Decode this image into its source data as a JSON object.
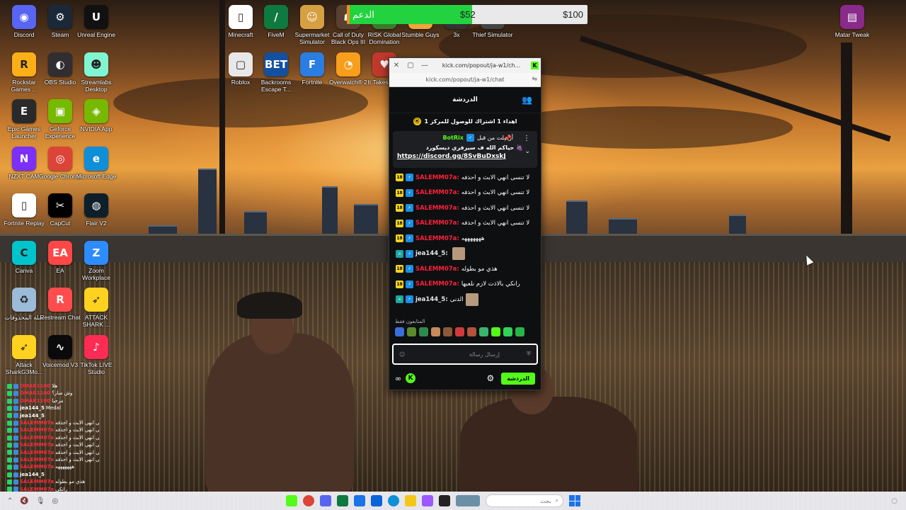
{
  "desktop_icons": [
    {
      "id": "discord",
      "label": "Discord",
      "color": "#5865f2",
      "glyph": "◉"
    },
    {
      "id": "steam",
      "label": "Steam",
      "color": "#1b2838",
      "glyph": "⚙"
    },
    {
      "id": "unreal",
      "label": "Unreal Engine",
      "color": "#111111",
      "glyph": "U"
    },
    {
      "id": "rockstar",
      "label": "Rockstar Games ...",
      "color": "#fcaf17",
      "glyph": "R"
    },
    {
      "id": "obs",
      "label": "OBS Studio",
      "color": "#302e31",
      "glyph": "◐"
    },
    {
      "id": "streamlabs",
      "label": "Streamlabs Desktop",
      "color": "#80f5d2",
      "glyph": "☻"
    },
    {
      "id": "epic",
      "label": "Epic Games Launcher",
      "color": "#2a2a2a",
      "glyph": "E"
    },
    {
      "id": "geforce",
      "label": "Geforce Experience",
      "color": "#76b900",
      "glyph": "▣"
    },
    {
      "id": "nvidia",
      "label": "NVIDIA App",
      "color": "#76b900",
      "glyph": "◈"
    },
    {
      "id": "nzxt",
      "label": "NZXT CAM",
      "color": "#7b2ff7",
      "glyph": "N"
    },
    {
      "id": "chrome",
      "label": "Google Chrome",
      "color": "#db4437",
      "glyph": "◎"
    },
    {
      "id": "edge",
      "label": "Microsoft Edge",
      "color": "#0f8fd8",
      "glyph": "e"
    },
    {
      "id": "fortnite",
      "label": "Fortnite Replay",
      "color": "#ffffff",
      "glyph": "▯"
    },
    {
      "id": "capcut",
      "label": "CapCut",
      "color": "#000000",
      "glyph": "✂"
    },
    {
      "id": "blackhole",
      "label": "Flair V2",
      "color": "#0d1f2a",
      "glyph": "◍"
    },
    {
      "id": "canva",
      "label": "Canva",
      "color": "#00c4cc",
      "glyph": "C"
    },
    {
      "id": "ea",
      "label": "EA",
      "color": "#ff4747",
      "glyph": "EA"
    },
    {
      "id": "zoom",
      "label": "Zoom Workplace",
      "color": "#2d8cff",
      "glyph": "Z"
    },
    {
      "id": "recycle",
      "label": "سلة المحذوفات",
      "color": "#9bbbd8",
      "glyph": "♻"
    },
    {
      "id": "restream",
      "label": "Restream Chat",
      "color": "#ff4c4c",
      "glyph": "R"
    },
    {
      "id": "attackshark",
      "label": "ATTACK SHARK ...",
      "color": "#ffd21f",
      "glyph": "➶"
    },
    {
      "id": "attack2",
      "label": "Attack SharkG3Mo...",
      "color": "#ffd21f",
      "glyph": "➶"
    },
    {
      "id": "voicemod",
      "label": "Voicemod V3",
      "color": "#0a0a0a",
      "glyph": "∿"
    },
    {
      "id": "tiktok",
      "label": "TikTok LIVE Studio",
      "color": "#fe2c55",
      "glyph": "♪"
    },
    {
      "id": "minecraft",
      "label": "Minecraft",
      "color": "#ffffff",
      "glyph": "▯"
    },
    {
      "id": "fivem",
      "label": "FiveM",
      "color": "#0f7a3f",
      "glyph": "/"
    },
    {
      "id": "supermarket",
      "label": "Supermarket Simulator",
      "color": "#d6a042",
      "glyph": "☺"
    },
    {
      "id": "cod",
      "label": "Call of Duty Black Ops III",
      "color": "#5a4030",
      "glyph": "☗"
    },
    {
      "id": "risk",
      "label": "RISK Global Domination",
      "color": "#3a7a2a",
      "glyph": "◆"
    },
    {
      "id": "stumble",
      "label": "Stumble Guys",
      "color": "#f2a43a",
      "glyph": "S"
    },
    {
      "id": "unknown1",
      "label": "3x",
      "color": "#333333",
      "glyph": "3"
    },
    {
      "id": "thief",
      "label": "Thief Simulator",
      "color": "#444444",
      "glyph": "T"
    },
    {
      "id": "roblox",
      "label": "Roblox",
      "color": "#e8e8e8",
      "glyph": "▢"
    },
    {
      "id": "backrooms",
      "label": "Backrooms Escape T...",
      "color": "#1450a0",
      "glyph": "BET"
    },
    {
      "id": "fortnite2",
      "label": "Fortnite",
      "color": "#2a7de1",
      "glyph": "F"
    },
    {
      "id": "overwatch",
      "label": "Overwatch® 2",
      "color": "#f99e1a",
      "glyph": "◔"
    },
    {
      "id": "ittakes",
      "label": "It Takes Two",
      "color": "#c0392b",
      "glyph": "♥"
    },
    {
      "id": "winrar",
      "label": "Matar Tweak",
      "color": "#8a2a8a",
      "glyph": "▤"
    }
  ],
  "donation_bar": {
    "label": "الدعم",
    "current": "$52",
    "goal": "$100",
    "progress": 0.52,
    "fill_color": "#22d33f"
  },
  "chat_window": {
    "tab_title": "kick.com/popout/ja-w1/ch...",
    "url": "kick.com/popout/ja-w1/chat",
    "header": "الدردشة",
    "goal_text": "اهداء 1 اشتراك للوصول للمركز 1",
    "pinned": {
      "pinned_by": "أرسلت من قبل",
      "bot": "BotRix",
      "message": "حياكم الله ف سيرفري ديسكورد 🍇",
      "link": "https://discord.gg/8SvBuDxskJ"
    },
    "messages": [
      {
        "badges": [
          "sub",
          "ver"
        ],
        "user": "SALEMM07a:",
        "text": "لا تنسى انهي الابث و احذفه",
        "color": "red"
      },
      {
        "badges": [
          "sub",
          "ver"
        ],
        "user": "SALEMM07a:",
        "text": "لا تنسى انهي الابث و احذفه",
        "color": "red"
      },
      {
        "badges": [
          "sub",
          "ver"
        ],
        "user": "SALEMM07a:",
        "text": "لا تنسى انهي الابث و احذفه",
        "color": "red"
      },
      {
        "badges": [
          "sub",
          "ver"
        ],
        "user": "SALEMM07a:",
        "text": "لا تنسى انهي الابث و احذفه",
        "color": "red"
      },
      {
        "badges": [
          "sub",
          "ver"
        ],
        "user": "SALEMM07a:",
        "text": "هههههههه",
        "color": "red"
      },
      {
        "badges": [
          "mod",
          "ver"
        ],
        "user": "jea144_5:",
        "text": "",
        "color": "white",
        "avatar": true
      },
      {
        "badges": [
          "sub",
          "ver"
        ],
        "user": "SALEMM07a:",
        "text": "هذي مو بطوله",
        "color": "red"
      },
      {
        "badges": [
          "sub",
          "ver"
        ],
        "user": "SALEMM07a:",
        "text": "رانكي بالاذت لازم نلعبها",
        "color": "red"
      },
      {
        "badges": [
          "mod",
          "ver"
        ],
        "user": "jea144_5:",
        "text": "الدنى",
        "color": "white",
        "avatar": true
      }
    ],
    "followers_label": "المتابعون فقط",
    "input_placeholder": "إرسال رسالة",
    "send_label": "الدردشة",
    "points": "∞"
  },
  "overlay_chat": [
    {
      "user": "OMAR1100",
      "text": "هلا",
      "color": "red"
    },
    {
      "user": "OMAR1100",
      "text": "وش صار؟",
      "color": "red"
    },
    {
      "user": "OMAR1100",
      "text": "مرحبا",
      "color": "red"
    },
    {
      "user": "jea144_5",
      "text": "Medal",
      "color": "white"
    },
    {
      "user": "jea144_5",
      "text": "",
      "color": "white"
    },
    {
      "user": "SALEMM07a",
      "text": "لا تنسى انهي الابث و احذفه",
      "color": "red"
    },
    {
      "user": "SALEMM07a",
      "text": "لا تنسى انهي الابث و احذفه",
      "color": "red"
    },
    {
      "user": "SALEMM07a",
      "text": "لا تنسى انهي الابث و احذفه",
      "color": "red"
    },
    {
      "user": "SALEMM07a",
      "text": "لا تنسى انهي الابث و احذفه",
      "color": "red"
    },
    {
      "user": "SALEMM07a",
      "text": "لا تنسى انهي الابث و احذفه",
      "color": "red"
    },
    {
      "user": "SALEMM07a",
      "text": "لا تنسى انهي الابث و احذفه",
      "color": "red"
    },
    {
      "user": "SALEMM07a",
      "text": "هههههههه",
      "color": "red"
    },
    {
      "user": "jea144_5",
      "text": "",
      "color": "white"
    },
    {
      "user": "SALEMM07a",
      "text": "هذي مو بطوله",
      "color": "red"
    },
    {
      "user": "SALEMM07a",
      "text": "رانكي",
      "color": "red"
    }
  ],
  "taskbar": {
    "search_placeholder": "بحث",
    "apps": [
      "kick",
      "chrome",
      "discord",
      "fivem",
      "store",
      "outlook",
      "edge",
      "explorer",
      "copilot",
      "terminal"
    ]
  }
}
